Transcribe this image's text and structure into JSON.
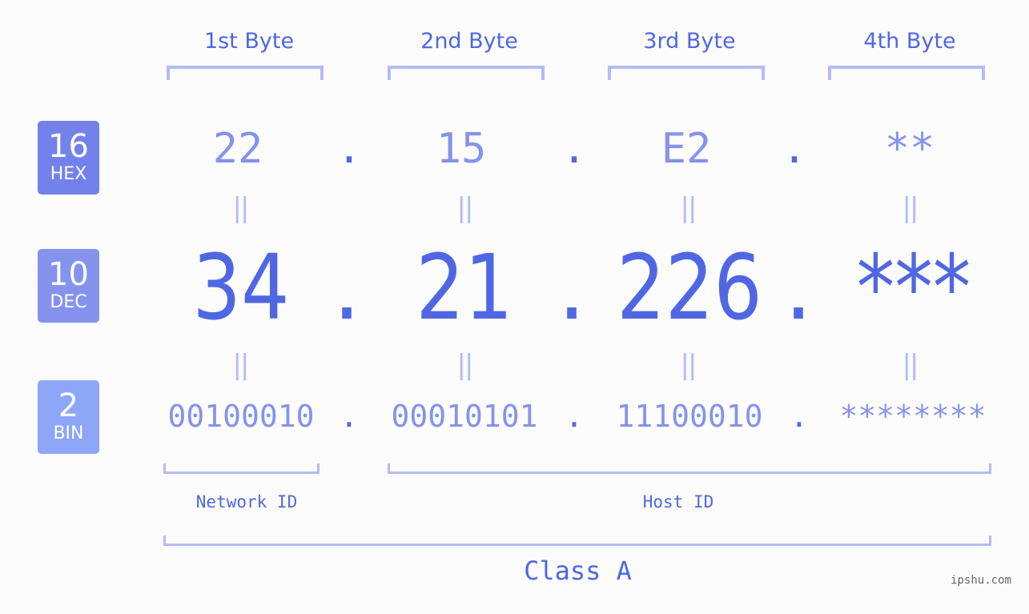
{
  "colors": {
    "primary": "#5067e4",
    "light": "#8593ec",
    "bracket": "#b3bcf5",
    "badge_hex": "#7382ea",
    "badge_dec": "#8593ef",
    "badge_bin": "#8ea6f8",
    "background": "#fbfcfb"
  },
  "badges": [
    {
      "base": "16",
      "label": "HEX"
    },
    {
      "base": "10",
      "label": "DEC"
    },
    {
      "base": "2",
      "label": "BIN"
    }
  ],
  "byte_headers": [
    "1st Byte",
    "2nd Byte",
    "3rd Byte",
    "4th Byte"
  ],
  "hex": [
    "22",
    "15",
    "E2",
    "**"
  ],
  "dec": [
    "34",
    "21",
    "226",
    "***"
  ],
  "bin": [
    "00100010",
    "00010101",
    "11100010",
    "********"
  ],
  "separator": ".",
  "equals": "||",
  "network_id_label": "Network ID",
  "host_id_label": "Host ID",
  "class_label": "Class A",
  "watermark": "ipshu.com"
}
